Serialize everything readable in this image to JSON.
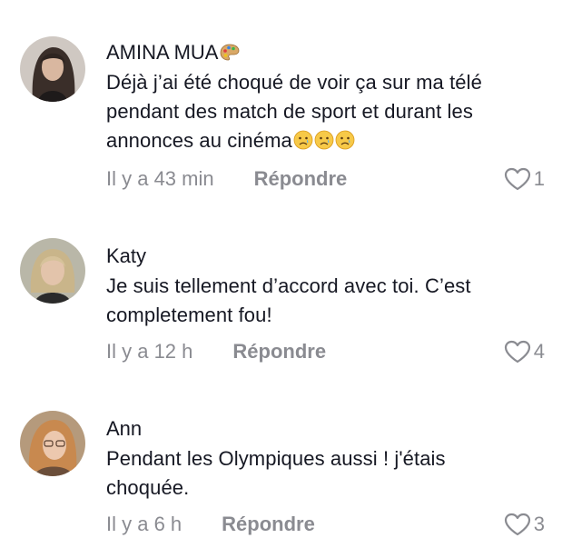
{
  "colors": {
    "text": "#161823",
    "muted": "#8a8b91",
    "background": "#ffffff"
  },
  "comments": [
    {
      "username": "AMINA MUA",
      "username_emoji": "artist-palette-icon",
      "text": "Déjà j’ai été choqué de voir ça sur ma télé pendant des match de sport et durant les annonces au cinéma",
      "text_emojis": [
        "crying-face-icon",
        "crying-face-icon",
        "crying-face-icon"
      ],
      "time": "Il y a 43 min",
      "reply_label": "Répondre",
      "like_icon": "heart-outline-icon",
      "likes": "1"
    },
    {
      "username": "Katy",
      "text": "Je suis tellement d’accord avec toi. C’est completement fou!",
      "time": "Il y a 12 h",
      "reply_label": "Répondre",
      "like_icon": "heart-outline-icon",
      "likes": "4"
    },
    {
      "username": "Ann",
      "text": "Pendant les Olympiques aussi ! j'étais choquée.",
      "time": "Il y a 6 h",
      "reply_label": "Répondre",
      "like_icon": "heart-outline-icon",
      "likes": "3"
    }
  ]
}
